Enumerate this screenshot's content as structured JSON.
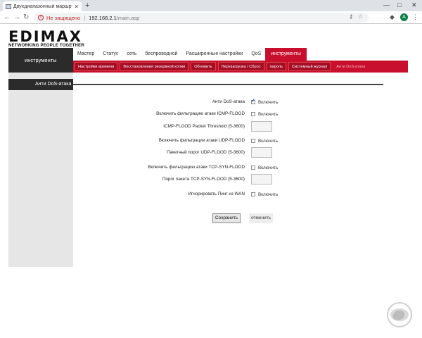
{
  "browser": {
    "tab_title": "Двухдиапазонный маршрутиз",
    "new_tab_symbol": "+",
    "security_label": "Не защищено",
    "url_host": "192.168.2.1",
    "url_path": "/main.asp",
    "avatar_letter": "А",
    "window_controls": [
      "—",
      "□",
      "✕"
    ],
    "nav_icons": [
      "back-icon",
      "forward-icon",
      "reload-icon"
    ],
    "colors": {
      "insecure": "#c5221f",
      "avatar": "#0b8043"
    }
  },
  "brand": {
    "logo_text": "EDIMAX",
    "slogan": "NETWORKING PEOPLE TOGETHER",
    "accent_color": "#c8102e"
  },
  "main_nav": [
    {
      "label": "Мастер",
      "active": false
    },
    {
      "label": "Статус",
      "active": false
    },
    {
      "label": "сеть",
      "active": false
    },
    {
      "label": "беспроводной",
      "active": false
    },
    {
      "label": "Расширенные настройки",
      "active": false
    },
    {
      "label": "QoS",
      "active": false
    },
    {
      "label": "инструменты",
      "active": true
    }
  ],
  "sub_nav": [
    {
      "label": "Настройки времени",
      "active": false
    },
    {
      "label": "Восстановления резервной копии",
      "active": false
    },
    {
      "label": "Обновить",
      "active": false
    },
    {
      "label": "Перезагрузка / Сброс",
      "active": false
    },
    {
      "label": "пароль",
      "active": false
    },
    {
      "label": "Системный журнал",
      "active": false
    },
    {
      "label": "Анти DoS-атака",
      "active": true
    }
  ],
  "sidebar": {
    "header": "инструменты",
    "selected_item": "Анти DoS-атака"
  },
  "form": {
    "rows": [
      {
        "label": "Анти DoS-атака",
        "type": "checkbox",
        "checked": true,
        "option": "Включить"
      },
      {
        "label": "Включить фильтрацию атаки ICMP-FLOOD",
        "type": "checkbox",
        "checked": false,
        "option": "Включить"
      },
      {
        "label": "ICMP-FLOOD Packet Threshold (5-3600)",
        "type": "input",
        "value": ""
      },
      {
        "label": "Включить фильтрации атаки UDP-FLOOD",
        "type": "checkbox",
        "checked": false,
        "option": "Включить"
      },
      {
        "label": "Пакетный порог UDP-FLOOD (5-3600)",
        "type": "input",
        "value": ""
      },
      {
        "label": "Включить фильтрацию атаки TCP-SYN-FLOOD",
        "type": "checkbox",
        "checked": false,
        "option": "Включить"
      },
      {
        "label": "Порог пакета TCP-SYN-FLOOD (5-3600)",
        "type": "input",
        "value": ""
      },
      {
        "label": "Игнорировать Пинг из WAN",
        "type": "checkbox",
        "checked": false,
        "option": "Включить"
      }
    ],
    "save_label": "Сохранить",
    "cancel_label": "отменить"
  }
}
